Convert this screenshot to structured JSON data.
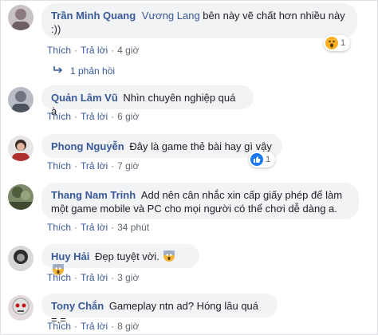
{
  "comments": [
    {
      "author": "Trần Minh Quang",
      "mention": "Vương Lang",
      "text": " bên này vẽ chất hơn nhiều này :))",
      "reaction_count": "1",
      "like": "Thích",
      "reply": "Trả lời",
      "time": "4 giờ",
      "replies_label": "1 phản hồi"
    },
    {
      "author": "Quản Lâm Vũ",
      "text": "Nhìn chuyên nghiệp quá à",
      "like": "Thích",
      "reply": "Trả lời",
      "time": "6 giờ"
    },
    {
      "author": "Phong Nguyễn",
      "text": "Đây là game thẻ bài hay gì vậy",
      "reaction_count": "1",
      "like": "Thích",
      "reply": "Trả lời",
      "time": "7 giờ"
    },
    {
      "author": "Thang Nam Trinh",
      "text": "Add nên cân nhắc xin cấp giấy phép để làm một game mobile và PC cho mọi người có thể chơi dễ dàng a.",
      "like": "Thích",
      "reply": "Trả lời",
      "time": "34 phút"
    },
    {
      "author": "Huy Hải",
      "text": "Đẹp tuyệt vời.",
      "like": "Thích",
      "reply": "Trả lời",
      "time": "3 giờ"
    },
    {
      "author": "Tony Chắn",
      "text": "Gameplay ntn ad? Hóng lâu quá =.=",
      "like": "Thích",
      "reply": "Trả lời",
      "time": "8 giờ"
    }
  ],
  "icons": {
    "reaction_wow": "wow-reaction-icon",
    "reaction_like": "like-reaction-icon",
    "reply_arrow": "reply-arrow-icon"
  },
  "colors": {
    "link": "#385898",
    "bubble": "#f2f3f5",
    "meta": "#606770"
  }
}
